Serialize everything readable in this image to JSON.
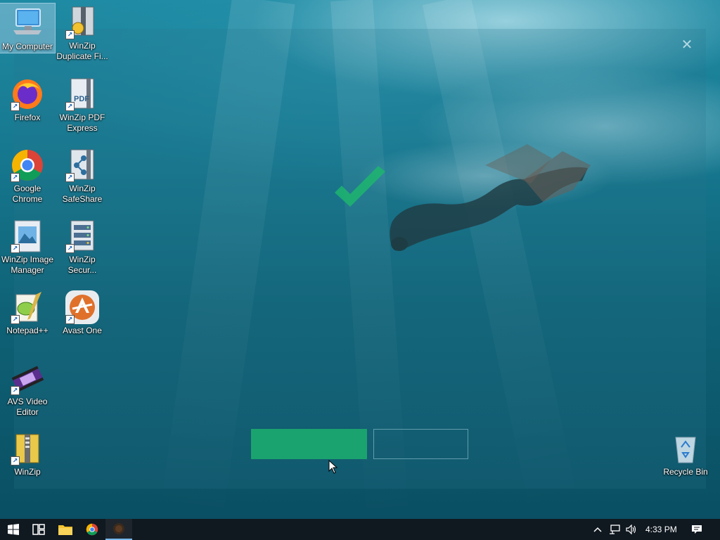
{
  "desktop": {
    "icons": [
      {
        "name": "icon-my-computer",
        "label": "My Computer"
      },
      {
        "name": "icon-firefox",
        "label": "Firefox"
      },
      {
        "name": "icon-google-chrome",
        "label": "Google Chrome"
      },
      {
        "name": "icon-winzip-image-manager",
        "label": "WinZip Image Manager"
      },
      {
        "name": "icon-notepad-plus-plus",
        "label": "Notepad++"
      },
      {
        "name": "icon-avs-video-editor",
        "label": "AVS Video Editor"
      },
      {
        "name": "icon-winzip",
        "label": "WinZip"
      },
      {
        "name": "icon-winzip-duplicate-files",
        "label": "WinZip Duplicate Fi..."
      },
      {
        "name": "icon-winzip-pdf-express",
        "label": "WinZip PDF Express"
      },
      {
        "name": "icon-winzip-safeshare",
        "label": "WinZip SafeShare"
      },
      {
        "name": "icon-winzip-secure",
        "label": "WinZip Secur..."
      },
      {
        "name": "icon-avast-one",
        "label": "Avast One"
      },
      {
        "name": "icon-recycle-bin",
        "label": "Recycle Bin"
      }
    ]
  },
  "installer": {
    "title": "",
    "heading": "",
    "subtitle": "",
    "primary_button": "",
    "secondary_button": "",
    "accent_color": "#1aa36e"
  },
  "taskbar": {
    "time": "4:33 PM",
    "icons": [
      "windows-start-icon",
      "task-view-icon",
      "file-explorer-icon",
      "chrome-icon",
      "installer-app-icon"
    ],
    "tray_icons": [
      "show-hidden-icons-chevron-icon",
      "network-icon",
      "volume-icon",
      "notification-icon"
    ]
  }
}
